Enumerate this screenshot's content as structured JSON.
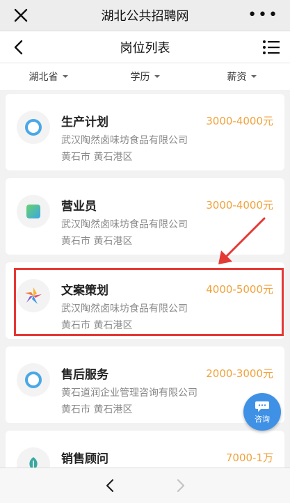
{
  "window": {
    "title": "湖北公共招聘网"
  },
  "nav": {
    "title": "岗位列表"
  },
  "filters": [
    {
      "label": "湖北省"
    },
    {
      "label": "学历"
    },
    {
      "label": "薪资"
    }
  ],
  "jobs": [
    {
      "title": "生产计划",
      "salary": "3000-4000元",
      "company": "武汉陶然卤味坊食品有限公司",
      "location": "黄石市 黄石港区",
      "logo": "blue-ring-logo"
    },
    {
      "title": "营业员",
      "salary": "3000-4000元",
      "company": "武汉陶然卤味坊食品有限公司",
      "location": "黄石市 黄石港区",
      "logo": "green-blue-square-logo"
    },
    {
      "title": "文案策划",
      "salary": "4000-5000元",
      "company": "武汉陶然卤味坊食品有限公司",
      "location": "黄石市 黄石港区",
      "logo": "colorful-pinwheel-logo"
    },
    {
      "title": "售后服务",
      "salary": "2000-3000元",
      "company": "黄石道润企业管理咨询有限公司",
      "location": "黄石市 黄石港区",
      "logo": "blue-ring-logo"
    },
    {
      "title": "销售顾问",
      "salary": "7000-1万",
      "company": "",
      "location": "",
      "logo": "leaf-logo"
    }
  ],
  "consult": {
    "label": "咨询"
  },
  "colors": {
    "salary": "#f0a23c",
    "highlight": "#e53935",
    "consult": "#3f91e6"
  }
}
